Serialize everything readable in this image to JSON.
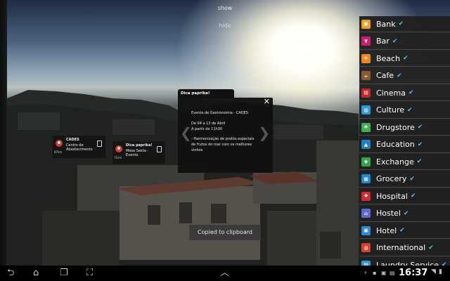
{
  "top": {
    "show_label": "show",
    "hide_label": "hide"
  },
  "pois": [
    {
      "title": "CADES",
      "line1": "Centro de",
      "line2": "Abastecimento",
      "distance": "87km"
    },
    {
      "title": "Dica paprika!",
      "line1": "Mesa Sexta -",
      "line2": "Evento",
      "distance": "71km"
    }
  ],
  "card": {
    "tab_title": "Dica paprika!",
    "lines": [
      "Evento de Gastronomia - CADES",
      "",
      "De 04 a 13 de Abril",
      "A partir de 11h30",
      "",
      "- Harmonização de pratos especiais",
      "de frutos do mar com os melhores",
      "vinhos"
    ]
  },
  "toast": "Copied to clipboard",
  "categories": [
    {
      "label": "Bank",
      "color": "#f0a020",
      "icon": "bank-icon",
      "glyph": "▣"
    },
    {
      "label": "Bar",
      "color": "#c81e6e",
      "icon": "bar-icon",
      "glyph": "Y"
    },
    {
      "label": "Beach",
      "color": "#f08a1c",
      "icon": "beach-icon",
      "glyph": "☀"
    },
    {
      "label": "Cafe",
      "color": "#8a5a2e",
      "icon": "cafe-icon",
      "glyph": "☕"
    },
    {
      "label": "Cinema",
      "color": "#c42626",
      "icon": "cinema-icon",
      "glyph": "▤"
    },
    {
      "label": "Culture",
      "color": "#2a9ad8",
      "icon": "culture-icon",
      "glyph": "▥"
    },
    {
      "label": "Drugstore",
      "color": "#3bb24a",
      "icon": "drugstore-icon",
      "glyph": "✚"
    },
    {
      "label": "Education",
      "color": "#1f82c8",
      "icon": "education-icon",
      "glyph": "▲"
    },
    {
      "label": "Exchange",
      "color": "#2fa84a",
      "icon": "exchange-icon",
      "glyph": "◆"
    },
    {
      "label": "Grocery",
      "color": "#1e88d0",
      "icon": "grocery-icon",
      "glyph": "▦"
    },
    {
      "label": "Hospital",
      "color": "#d62828",
      "icon": "hospital-icon",
      "glyph": "✚"
    },
    {
      "label": "Hostel",
      "color": "#5a6ad0",
      "icon": "hostel-icon",
      "glyph": "⌂"
    },
    {
      "label": "Hotel",
      "color": "#2a8ad8",
      "icon": "hotel-icon",
      "glyph": "▣"
    },
    {
      "label": "International",
      "color": "#d8402a",
      "icon": "international-icon",
      "glyph": "◍"
    },
    {
      "label": "Laundry Service",
      "color": "#2a9ad8",
      "icon": "laundry-icon",
      "glyph": "▤"
    }
  ],
  "checkmark": "✔",
  "status": {
    "time": "16:37"
  }
}
